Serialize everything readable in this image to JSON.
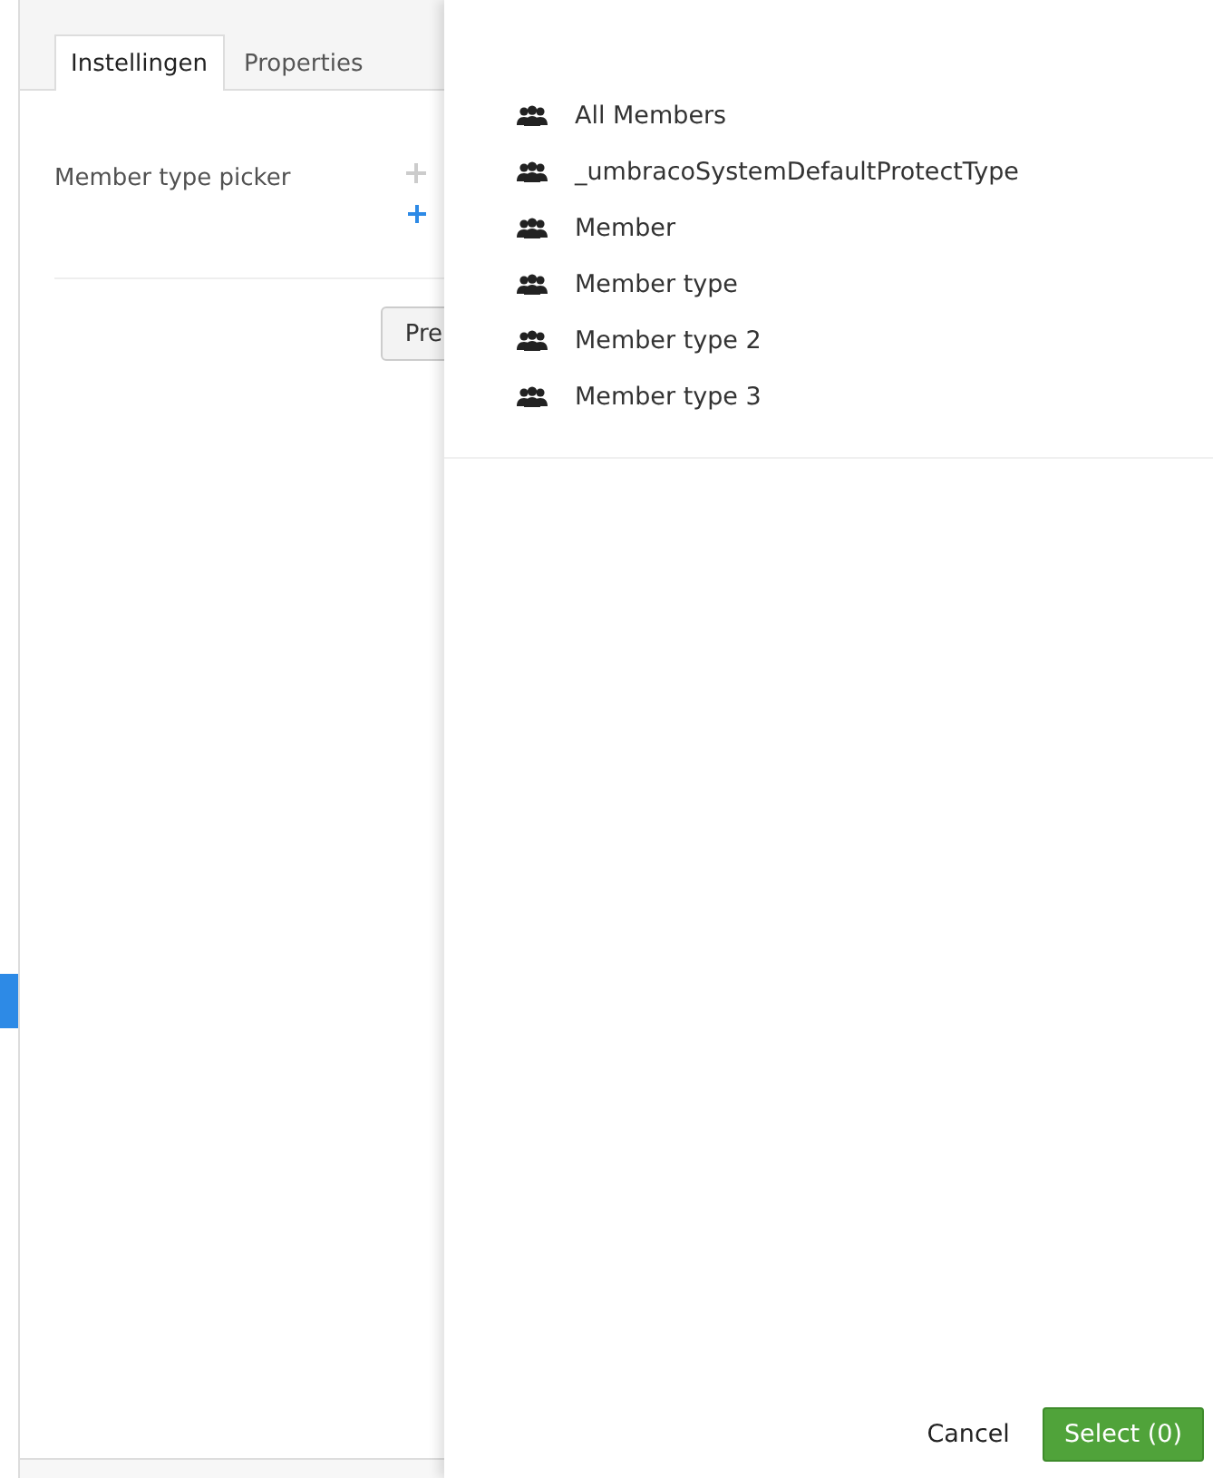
{
  "editor": {
    "tabs": [
      {
        "label": "Instellingen",
        "selected": true
      },
      {
        "label": "Properties",
        "selected": false
      }
    ],
    "property": {
      "label": "Member type picker"
    },
    "preview_button": "Pre"
  },
  "picker": {
    "items": [
      {
        "label": "All Members"
      },
      {
        "label": "_umbracoSystemDefaultProtectType"
      },
      {
        "label": "Member"
      },
      {
        "label": "Member type"
      },
      {
        "label": "Member type 2"
      },
      {
        "label": "Member type 3"
      }
    ],
    "cancel": "Cancel",
    "select": "Select (0)"
  }
}
